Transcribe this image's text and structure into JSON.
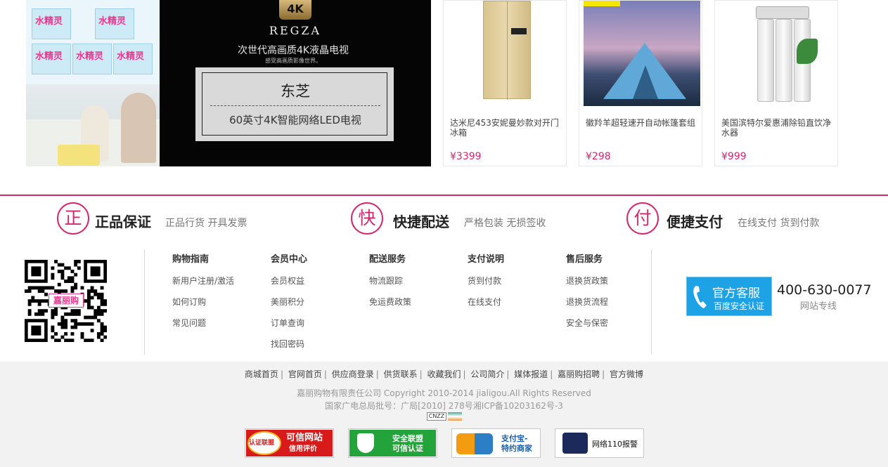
{
  "promo": {
    "water_brand": "水精灵",
    "tv_badge": "4K",
    "tv_brand": "REGZA",
    "tv_tagline": "次世代高画质4K液晶电视",
    "tv_subtagline": "感受高画质影像世界。",
    "tv_card_title": "东芝",
    "tv_card_subtitle": "60英寸4K智能网络LED电视"
  },
  "products": [
    {
      "name": "达米尼453安妮曼妙款对开门冰箱",
      "price": "¥3399"
    },
    {
      "name": "徽羚羊超轻速开自动帐篷套组",
      "price": "¥298"
    },
    {
      "name": "美国滨特尔爱惠浦除铅直饮净水器",
      "price": "¥999"
    }
  ],
  "guarantees": [
    {
      "icon_char": "正",
      "title": "正品保证",
      "subtitle": "正品行货 开具发票"
    },
    {
      "icon_char": "快",
      "title": "快捷配送",
      "subtitle": "严格包装 无损签收"
    },
    {
      "icon_char": "付",
      "title": "便捷支付",
      "subtitle": "在线支付 货到付款"
    }
  ],
  "qr_logo": "嘉丽购",
  "columns": [
    {
      "title": "购物指南",
      "items": [
        "新用户注册/激活",
        "如何订购",
        "常见问题"
      ]
    },
    {
      "title": "会员中心",
      "items": [
        "会员权益",
        "美丽积分",
        "订单查询",
        "找回密码"
      ]
    },
    {
      "title": "配送服务",
      "items": [
        "物流跟踪",
        "免运费政策"
      ]
    },
    {
      "title": "支付说明",
      "items": [
        "货到付款",
        "在线支付"
      ]
    },
    {
      "title": "售后服务",
      "items": [
        "退换货政策",
        "退换货流程",
        "安全与保密"
      ]
    }
  ],
  "service": {
    "title": "官方客服",
    "subtitle": "百度安全认证",
    "phone": "400-630-0077",
    "phone_label": "网站专线"
  },
  "footer": {
    "links": [
      "商城首页",
      "官网首页",
      "供应商登录",
      "供货联系",
      "收藏我们",
      "公司简介",
      "媒体报道",
      "嘉丽购招聘",
      "官方微博"
    ],
    "copyright": "嘉丽购物有限责任公司 Copyright 2010-2014 jialigou.All Rights Reserved",
    "icp": "国家广电总局批号：广局[2010] 278号湘ICP备10203162号-3",
    "cnzz": "CNZZ",
    "badges": [
      {
        "line1": "可信网站",
        "line2": "信用评价",
        "seal": "认证联盟"
      },
      {
        "line1": "安全联盟",
        "line2": "可信认证"
      },
      {
        "line1": "支付宝-",
        "line2": "特约商家"
      },
      {
        "line1": "网络110报警"
      }
    ]
  },
  "colors": {
    "accent": "#d6266e",
    "price": "#e0206f",
    "service_blue": "#1ea2e6"
  }
}
